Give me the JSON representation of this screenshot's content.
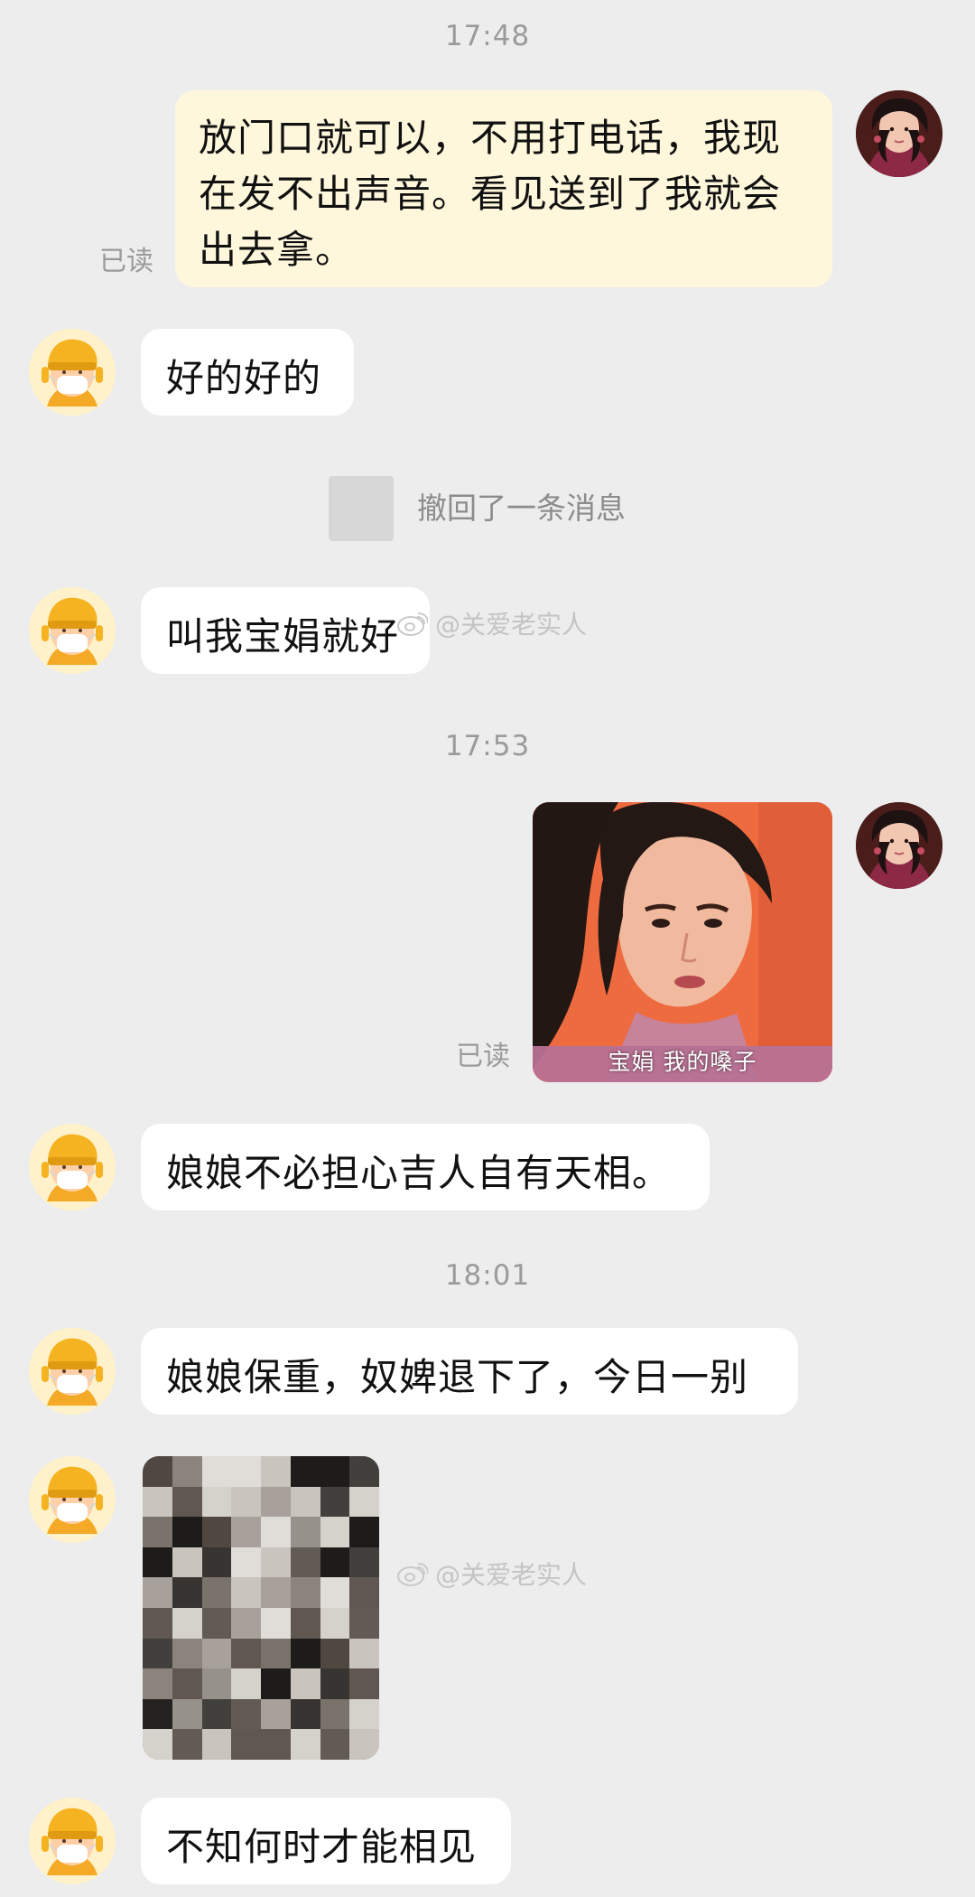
{
  "conversation": {
    "messages": [
      {
        "type": "time",
        "text": "17:48"
      },
      {
        "type": "outgoing-text",
        "text": "放门口就可以，不用打电话，我现在发不出声音。看见送到了我就会出去拿。",
        "read_status": "已读"
      },
      {
        "type": "incoming-text",
        "text": "好的好的"
      },
      {
        "type": "recall-notice",
        "text": "撤回了一条消息"
      },
      {
        "type": "incoming-text",
        "text": "叫我宝娟就好"
      },
      {
        "type": "time",
        "text": "17:53"
      },
      {
        "type": "outgoing-sticker",
        "caption": "宝娟 我的嗓子",
        "read_status": "已读"
      },
      {
        "type": "incoming-text",
        "text": "娘娘不必担心吉人自有天相。"
      },
      {
        "type": "time",
        "text": "18:01"
      },
      {
        "type": "incoming-text",
        "text": "娘娘保重，奴婢退下了，今日一别"
      },
      {
        "type": "incoming-image"
      },
      {
        "type": "incoming-text",
        "text": "不知何时才能相见"
      }
    ]
  },
  "watermarks": [
    {
      "text": "@关爱老实人"
    },
    {
      "text": "@关爱老实人"
    }
  ],
  "avatars": {
    "courier": "courier-with-mask-avatar",
    "user": "woman-portrait-avatar"
  },
  "colors": {
    "background": "#ededed",
    "incoming_bubble": "#ffffff",
    "outgoing_bubble": "#fff7dc",
    "time_text": "#9a9a9a",
    "avatar_yellow": "#f6b626",
    "sticker_orange": "#ee6a3f"
  }
}
